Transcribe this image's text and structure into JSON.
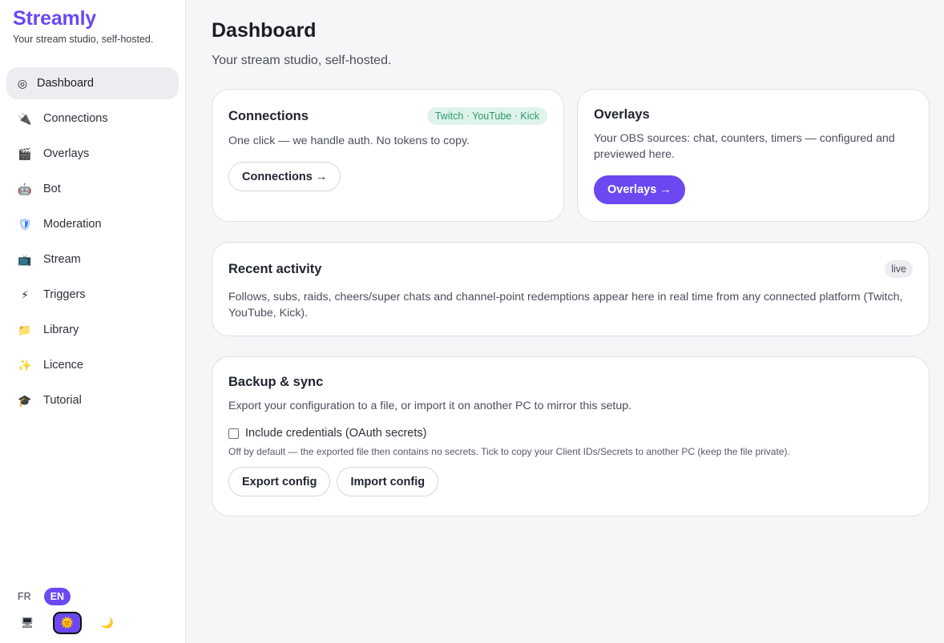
{
  "sidebar": {
    "brand_name": "Streamly",
    "brand_tagline": "Your stream studio, self-hosted.",
    "items": [
      {
        "label": "Dashboard",
        "icon": "◎"
      },
      {
        "label": "Connections",
        "icon": "🔌"
      },
      {
        "label": "Overlays",
        "icon": "🎬"
      },
      {
        "label": "Bot",
        "icon": "🤖"
      },
      {
        "label": "Moderation",
        "icon": "🛡"
      },
      {
        "label": "Stream",
        "icon": "📺"
      },
      {
        "label": "Triggers",
        "icon": "⚡"
      },
      {
        "label": "Library",
        "icon": "📁"
      },
      {
        "label": "Licence",
        "icon": "✨"
      },
      {
        "label": "Tutorial",
        "icon": "🎓"
      }
    ],
    "languages": [
      "FR",
      "EN"
    ],
    "active_language": "EN",
    "themes": {
      "system": "🖥",
      "light": "🌞",
      "dark": "🌙"
    },
    "active_theme": "light"
  },
  "main": {
    "title": "Dashboard",
    "subtitle": "Your stream studio, self-hosted.",
    "connections": {
      "title": "Connections",
      "badge": "Twitch · YouTube · Kick",
      "text": "One click — we handle auth. No tokens to copy.",
      "button": "Connections →"
    },
    "overlays": {
      "title": "Overlays",
      "text": "Your OBS sources: chat, counters, timers — configured and previewed here.",
      "button": "Overlays →"
    },
    "activity": {
      "title": "Recent activity",
      "badge": "live",
      "text": "Follows, subs, raids, cheers/super chats and channel-point redemptions appear here in real time from any connected platform (Twitch, YouTube, Kick)."
    },
    "backup": {
      "title": "Backup & sync",
      "text": "Export your configuration to a file, or import it on another PC to mirror this setup.",
      "checkbox_label": "Include credentials (OAuth secrets)",
      "hint": "Off by default — the exported file then contains no secrets. Tick to copy your Client IDs/Secrets to another PC (keep the file private).",
      "export_button": "Export config",
      "import_button": "Import config"
    }
  },
  "colors": {
    "accent": "#6b48f0",
    "badge_green_bg": "#dff3ea",
    "badge_green_text": "#2a9a6b"
  }
}
